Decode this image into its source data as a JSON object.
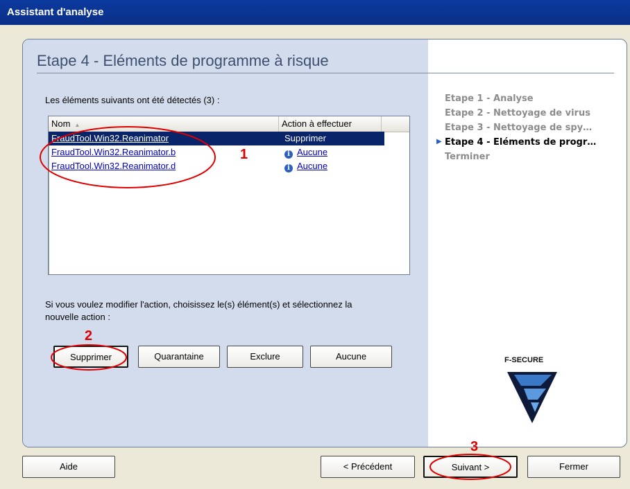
{
  "window": {
    "title": "Assistant d'analyse"
  },
  "step_title": "Etape 4 - Eléments de programme à risque",
  "detected_label": "Les éléments suivants ont été détectés (3) :",
  "list": {
    "columns": [
      "Nom",
      "Action à effectuer"
    ],
    "rows": [
      {
        "name": "FraudTool.Win32.Reanimator",
        "action": "Supprimer",
        "selected": true
      },
      {
        "name": "FraudTool.Win32.Reanimator.b",
        "action": "Aucune",
        "selected": false
      },
      {
        "name": "FraudTool.Win32.Reanimator.d",
        "action": "Aucune",
        "selected": false
      }
    ]
  },
  "hint": "Si vous voulez modifier l'action, choisissez le(s) élément(s) et sélectionnez la nouvelle action :",
  "action_buttons": [
    "Supprimer",
    "Quarantaine",
    "Exclure",
    "Aucune"
  ],
  "steps": [
    {
      "label": "Etape 1 - Analyse",
      "current": false
    },
    {
      "label": "Etape 2 - Nettoyage de virus",
      "current": false
    },
    {
      "label": "Etape 3 - Nettoyage de spy…",
      "current": false
    },
    {
      "label": "Etape 4 - Eléments de progr…",
      "current": true
    },
    {
      "label": "Terminer",
      "current": false
    }
  ],
  "logo_text": "F-SECURE",
  "nav_buttons": {
    "help": "Aide",
    "previous": "< Précédent",
    "next": "Suivant >",
    "close": "Fermer"
  },
  "annotations": [
    "1",
    "2",
    "3"
  ],
  "colors": {
    "title_bar": "#0a2f86",
    "selection": "#0a246a",
    "annotation": "#e00000",
    "link": "#0000c8"
  }
}
